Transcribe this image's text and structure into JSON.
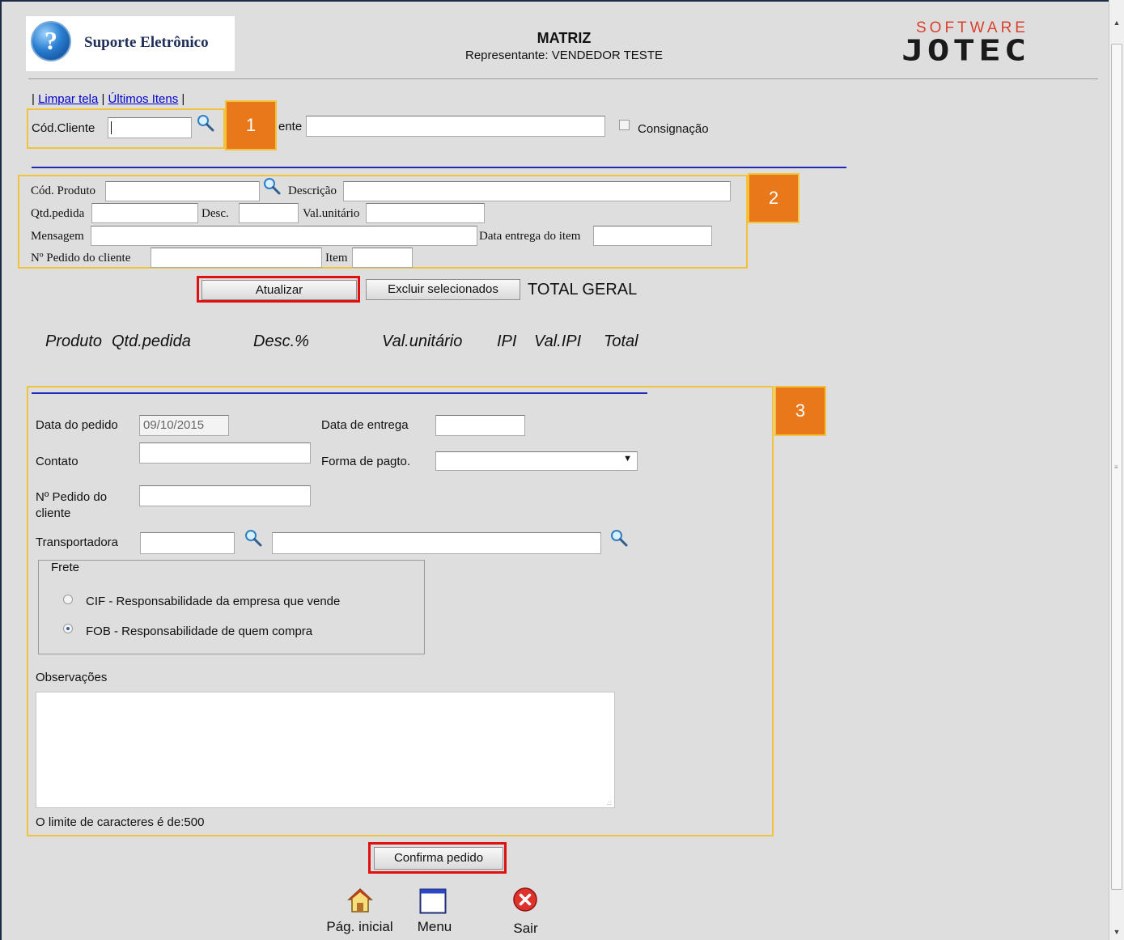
{
  "header": {
    "logo_text": "Suporte Eletrônico",
    "title": "MATRIZ",
    "subtitle": "Representante: VENDEDOR TESTE",
    "brand_top": "SOFTWARE",
    "brand_main": "JOTEC"
  },
  "links": {
    "sep1": "|",
    "clear_screen": "Limpar tela",
    "sep2": "|",
    "last_items": "Últimos Itens",
    "sep3": "|"
  },
  "client": {
    "code_label": "Cód.Cliente",
    "code_value": "",
    "name_label_partial": "ente",
    "name_value": "",
    "consignment_label": "Consignação",
    "consignment_checked": false
  },
  "product": {
    "code_label": "Cód. Produto",
    "description_label": "Descrição",
    "qty_label": "Qtd.pedida",
    "discount_label": "Desc.",
    "unit_value_label": "Val.unitário",
    "message_label": "Mensagem",
    "delivery_item_label": "Data entrega do item",
    "client_order_label": "Nº Pedido do cliente",
    "item_label": "Item"
  },
  "actions": {
    "update": "Atualizar",
    "delete_selected": "Excluir selecionados",
    "grand_total": "TOTAL GERAL"
  },
  "items_table": {
    "columns": [
      "Produto",
      "Qtd.pedida",
      "Desc.%",
      "Val.unitário",
      "IPI",
      "Val.IPI",
      "Total"
    ]
  },
  "order": {
    "order_date_label": "Data do pedido",
    "order_date_value": "09/10/2015",
    "delivery_date_label": "Data de entrega",
    "delivery_date_value": "",
    "contact_label": "Contato",
    "payment_label": "Forma de pagto.",
    "payment_value": "",
    "client_order_label_line1": "Nº Pedido do",
    "client_order_label_line2": "cliente",
    "carrier_label": "Transportadora",
    "freight": {
      "legend": "Frete",
      "options": [
        {
          "label": "CIF - Responsabilidade da empresa que vende",
          "checked": false
        },
        {
          "label": "FOB - Responsabilidade de quem compra",
          "checked": true
        }
      ]
    },
    "notes_label": "Observações",
    "notes_value": "",
    "char_limit_text": "O limite de caracteres é de:500",
    "confirm": "Confirma pedido"
  },
  "callouts": [
    "1",
    "2",
    "3"
  ],
  "bottom_nav": {
    "home": "Pág. inicial",
    "menu": "Menu",
    "exit": "Sair"
  },
  "colors": {
    "background": "#dedede",
    "callout_frame": "#f2c23a",
    "callout_badge": "#e8781a",
    "highlight_red": "#e11010",
    "link_blue": "#0000cc",
    "rule_blue": "#1f2bb8"
  }
}
